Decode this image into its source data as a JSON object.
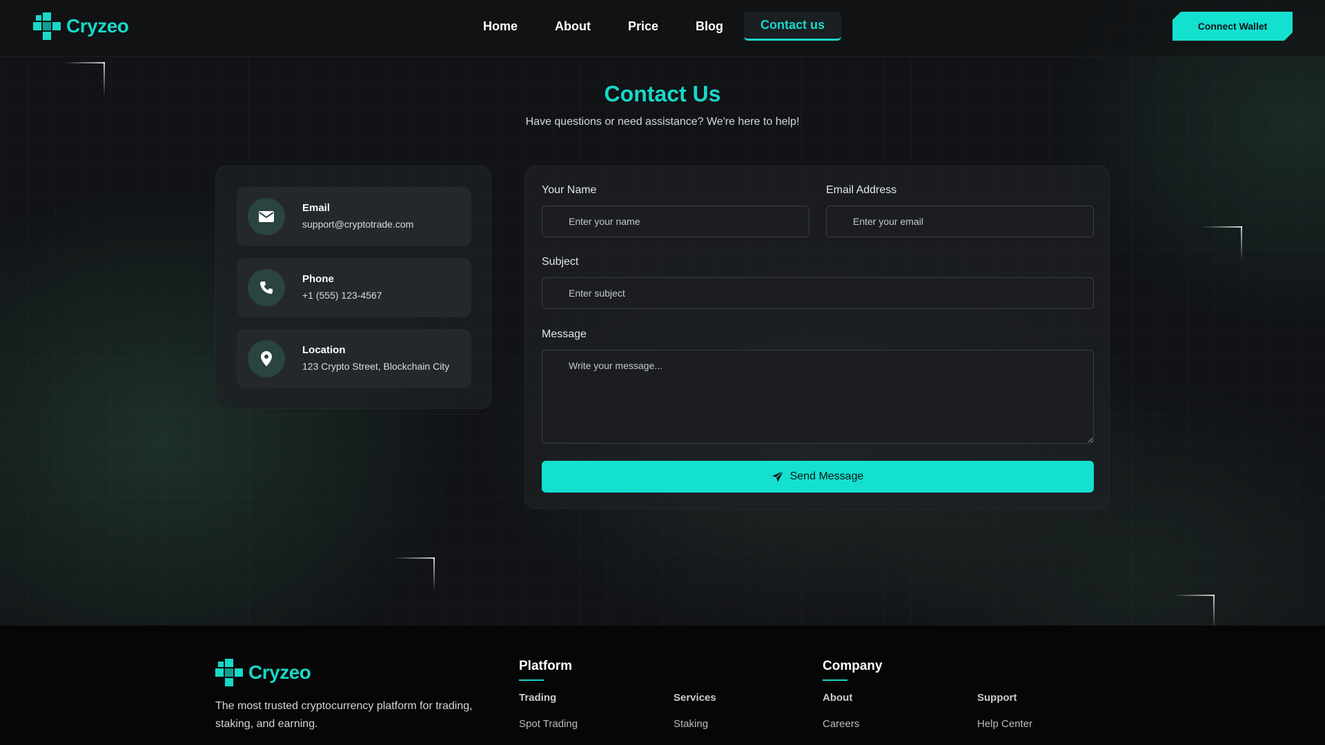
{
  "brand": {
    "name": "Cryzeo",
    "accent": "#18d8c8"
  },
  "nav": {
    "items": [
      "Home",
      "About",
      "Price",
      "Blog",
      "Contact us"
    ],
    "active": "Contact us",
    "connect_label": "Connect Wallet"
  },
  "hero": {
    "title": "Contact Us",
    "subtitle": "Have questions or need assistance? We're here to help!"
  },
  "contact_info": [
    {
      "label": "Email",
      "value": "support@cryptotrade.com",
      "icon": "envelope-icon"
    },
    {
      "label": "Phone",
      "value": "+1 (555) 123-4567",
      "icon": "phone-icon"
    },
    {
      "label": "Location",
      "value": "123 Crypto Street, Blockchain City",
      "icon": "map-pin-icon"
    }
  ],
  "form": {
    "name_label": "Your Name",
    "name_placeholder": "Enter your name",
    "email_label": "Email Address",
    "email_placeholder": "Enter your email",
    "subject_label": "Subject",
    "subject_placeholder": "Enter subject",
    "message_label": "Message",
    "message_placeholder": "Write your message...",
    "submit_label": "Send Message"
  },
  "footer": {
    "brand": "Cryzeo",
    "description": "The most trusted cryptocurrency platform for trading, staking, and earning.",
    "platform_heading": "Platform",
    "company_heading": "Company",
    "columns": [
      {
        "title": "Trading",
        "links": [
          "Spot Trading"
        ]
      },
      {
        "title": "Services",
        "links": [
          "Staking"
        ]
      },
      {
        "title": "About",
        "links": [
          "Careers"
        ]
      },
      {
        "title": "Support",
        "links": [
          "Help Center"
        ]
      }
    ]
  }
}
